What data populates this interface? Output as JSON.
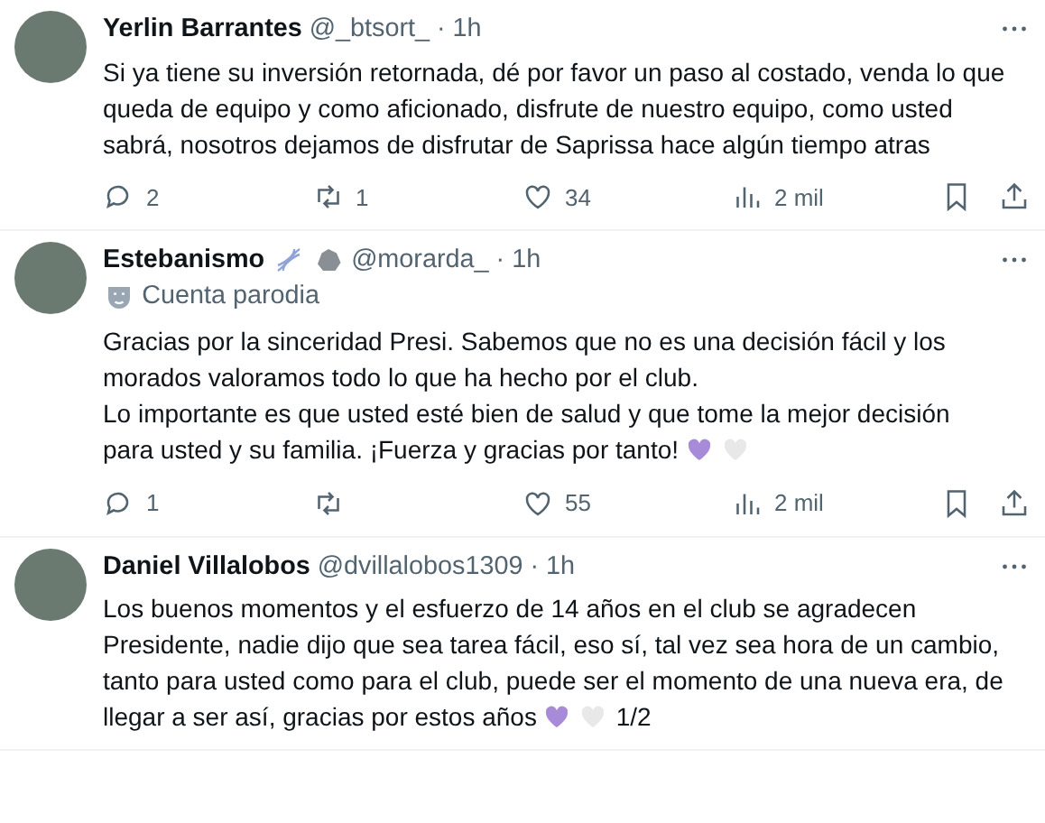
{
  "tweets": [
    {
      "name": "Yerlin Barrantes",
      "handle": "@_btsort_",
      "time": "· 1h",
      "paragraphs": [
        {
          "text": "Si ya tiene su inversión retornada, dé por favor un paso al costado, venda lo que queda de equipo y como aficionado, disfrute de nuestro equipo, como usted sabrá, nosotros dejamos de disfrutar de Saprissa hace algún tiempo atras"
        }
      ],
      "actions": {
        "replies": "2",
        "reposts": "1",
        "likes": "34",
        "views": "2 mil"
      }
    },
    {
      "name": "Estebanismo",
      "handle": "@morarda_",
      "time": "· 1h",
      "badges": [
        {
          "kind": "dna"
        },
        {
          "kind": "blob"
        }
      ],
      "parody": "Cuenta parodia",
      "paragraphs": [
        {
          "text": "Gracias por la sinceridad Presi. Sabemos que no es una decisión fácil y los morados valoramos todo lo que ha hecho por el club."
        },
        {
          "text": "Lo importante es que usted esté bien de salud y que tome la mejor decisión para usted y su familia. ¡Fuerza y gracias por tanto!",
          "hearts": [
            {
              "color": "#a78bd9"
            },
            {
              "color": "#e8e8e8"
            }
          ]
        }
      ],
      "actions": {
        "replies": "1",
        "likes": "55",
        "views": "2 mil"
      }
    },
    {
      "name": "Daniel Villalobos",
      "handle": "@dvillalobos1309",
      "time": "· 1h",
      "paragraphs": [
        {
          "text": "Los buenos momentos y el esfuerzo de 14 años en el club se agradecen Presidente, nadie dijo que sea tarea fácil, eso sí, tal vez sea hora de un cambio, tanto para usted como para el club, puede ser el momento de una nueva era, de llegar a ser así, gracias por estos años",
          "hearts": [
            {
              "color": "#a78bd9"
            },
            {
              "color": "#e8e8e8"
            }
          ],
          "suffix": "1/2"
        }
      ]
    }
  ]
}
